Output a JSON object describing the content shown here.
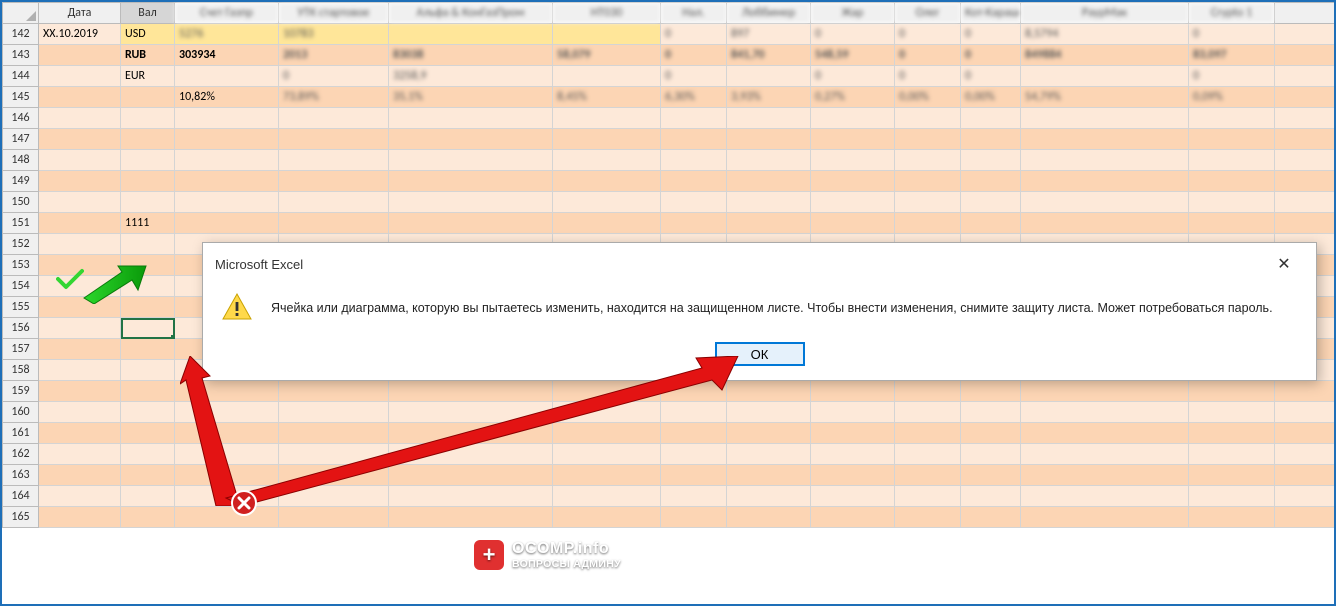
{
  "headers": {
    "c0": "Дата",
    "c1": "Вал",
    "c2": "Счет Газпр",
    "c3": "УТК стартовое",
    "c4": "Альфа & КонГазПром",
    "c5": "НТ030",
    "c6": "Нал.",
    "c7": "Лоббимер",
    "c8": "Жар",
    "c9": "Олег",
    "c10": "Кот-Карашев ПМ-Штрафы",
    "c11": "РаурМак",
    "c12": "Crypto 1"
  },
  "rows": {
    "r142": {
      "date": "XX.10.2019",
      "cur": "USD",
      "v2": "5276",
      "v3": "10783",
      "v6": "0",
      "v7": "897",
      "v8": "0",
      "v9": "0",
      "v10": "0",
      "v11": "8,5794",
      "v12": "0"
    },
    "r143": {
      "cur": "RUB",
      "v1": "303934",
      "v2": "2013",
      "v3": "83038",
      "v5": "58,079",
      "v6": "0",
      "v7": "841,70",
      "v8": "548,59",
      "v9": "0",
      "v10": "0",
      "v11": "849884",
      "v12": "83,097"
    },
    "r144": {
      "cur": "EUR",
      "v2": "0",
      "v3": "3258,9",
      "v6": "0",
      "v8": "0",
      "v9": "0",
      "v10": "0",
      "v12": "0"
    },
    "r145": {
      "v1": "10,82%",
      "v2": "73,89%",
      "v3": "35,1%",
      "v5": "8,45%",
      "v6": "6,30%",
      "v7": "3,93%",
      "v8": "0,27%",
      "v9": "0,00%",
      "v10": "0,00%",
      "v11": "54,79%",
      "v12": "0,09%"
    },
    "r151": {
      "cur": "1111"
    }
  },
  "rowNumbers": [
    142,
    143,
    144,
    145,
    146,
    147,
    148,
    149,
    150,
    151,
    152,
    153,
    154,
    155,
    156,
    157,
    158,
    159,
    160,
    161,
    162,
    163,
    164,
    165
  ],
  "dialog": {
    "title": "Microsoft Excel",
    "message": "Ячейка или диаграмма, которую вы пытаетесь изменить, находится на защищенном листе. Чтобы внести изменения, снимите защиту листа. Может потребоваться пароль.",
    "ok": "ОК"
  },
  "watermark": {
    "line1": "OCOMP.info",
    "line2": "ВОПРОСЫ АДМИНУ",
    "badge": "+"
  }
}
